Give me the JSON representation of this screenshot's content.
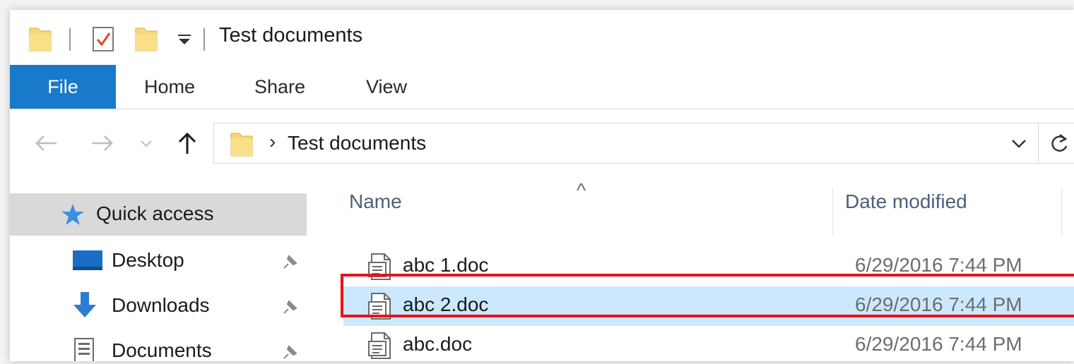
{
  "window": {
    "title": "Test documents"
  },
  "ribbon": {
    "tabs": [
      {
        "label": "File",
        "active": true
      },
      {
        "label": "Home"
      },
      {
        "label": "Share"
      },
      {
        "label": "View"
      }
    ]
  },
  "navbar": {
    "back_icon": "back-arrow-icon",
    "forward_icon": "forward-arrow-icon",
    "recent_icon": "recent-dropdown-icon",
    "up_icon": "up-arrow-icon",
    "separator": "›",
    "address": "Test documents",
    "dropdown_icon": "chevron-down-icon",
    "refresh_icon": "refresh-icon"
  },
  "nav_pane": {
    "items": [
      {
        "label": "Quick access",
        "icon": "star-icon",
        "selected": true
      },
      {
        "label": "Desktop",
        "icon": "desktop-icon",
        "pinned": true
      },
      {
        "label": "Downloads",
        "icon": "download-icon",
        "pinned": true
      },
      {
        "label": "Documents",
        "icon": "documents-icon",
        "pinned": true
      }
    ]
  },
  "file_list": {
    "sort_indicator": "^",
    "columns": [
      "Name",
      "Date modified"
    ],
    "rows": [
      {
        "name": "abc 1.doc",
        "date_modified": "6/29/2016 7:44 PM",
        "selected": false
      },
      {
        "name": "abc 2.doc",
        "date_modified": "6/29/2016 7:44 PM",
        "selected": true
      },
      {
        "name": "abc.doc",
        "date_modified": "6/29/2016 7:44 PM",
        "selected": false
      }
    ]
  },
  "colors": {
    "file_tab": "#1979ca",
    "selection": "#cce8ff",
    "highlight_border": "#e8141b",
    "folder": "#f8d775",
    "header_text": "#4c607a",
    "date_text": "#6d6d6d"
  }
}
